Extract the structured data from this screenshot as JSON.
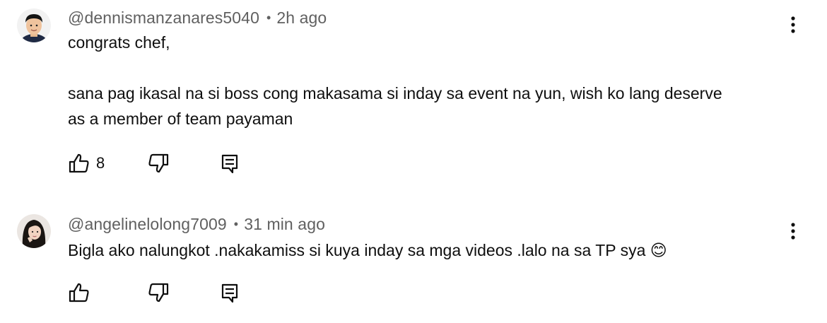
{
  "comments": [
    {
      "author": "@dennismanzanares5040",
      "time": "2h ago",
      "lines": [
        "congrats chef,",
        "",
        "sana pag ikasal na si boss cong makasama si inday sa event na yun, wish ko lang deserve",
        "as a member of team payaman"
      ],
      "likes": "8"
    },
    {
      "author": "@angelinelolong7009",
      "time": "31 min ago",
      "lines": [
        "Bigla ako nalungkot .nakakamiss si kuya inday sa mga videos .lalo na sa TP sya 😊"
      ],
      "likes": ""
    }
  ],
  "meta_separator": "•",
  "icons": {
    "like": "thumbs-up-icon",
    "dislike": "thumbs-down-icon",
    "reply": "reply-comment-icon",
    "more": "more-vertical-icon"
  },
  "colors": {
    "text": "#0f0f0f",
    "secondary": "#606060",
    "background": "#ffffff"
  }
}
